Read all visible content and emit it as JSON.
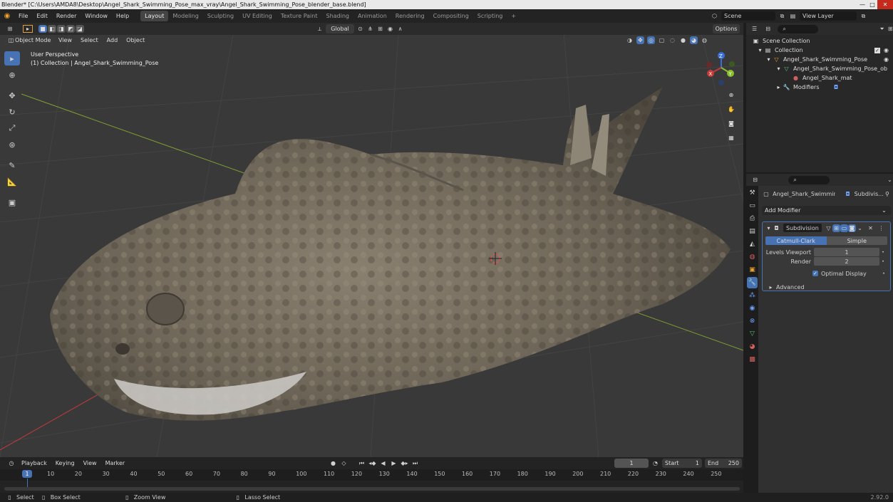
{
  "window": {
    "title": "Blender* [C:\\Users\\AMDA8\\Desktop\\Angel_Shark_Swimming_Pose_max_vray\\Angel_Shark_Swimming_Pose_blender_base.blend]",
    "min": "—",
    "max": "□",
    "close": "✕"
  },
  "menubar": {
    "items": [
      "File",
      "Edit",
      "Render",
      "Window",
      "Help"
    ],
    "workspaces": [
      "Layout",
      "Modeling",
      "Sculpting",
      "UV Editing",
      "Texture Paint",
      "Shading",
      "Animation",
      "Rendering",
      "Compositing",
      "Scripting"
    ],
    "add_tab": "+",
    "scene": "Scene",
    "view_layer": "View Layer"
  },
  "viewport": {
    "mode": "Object Mode",
    "menus": [
      "View",
      "Select",
      "Add",
      "Object"
    ],
    "orientation": "Global",
    "options": "Options",
    "overlay_title": "User Perspective",
    "overlay_subtitle": "(1) Collection | Angel_Shark_Swimming_Pose",
    "gizmo_axes": {
      "x": "X",
      "y": "Y",
      "z": "Z"
    }
  },
  "timeline": {
    "menus": [
      "Playback",
      "Keying",
      "View",
      "Marker"
    ],
    "current_frame": "1",
    "start_label": "Start",
    "start": "1",
    "end_label": "End",
    "end": "250",
    "ticks": [
      "10",
      "20",
      "30",
      "40",
      "50",
      "60",
      "70",
      "80",
      "90",
      "100",
      "110",
      "120",
      "130",
      "140",
      "150",
      "160",
      "170",
      "180",
      "190",
      "200",
      "210",
      "220",
      "230",
      "240",
      "250"
    ],
    "playhead": "1"
  },
  "outliner": {
    "scene_collection": "Scene Collection",
    "collection": "Collection",
    "object": "Angel_Shark_Swimming_Pose",
    "mesh": "Angel_Shark_Swimming_Pose_ob",
    "material": "Angel_Shark_mat",
    "modifiers": "Modifiers"
  },
  "properties": {
    "object_name": "Angel_Shark_Swimmin...",
    "modifier_crumb": "Subdivis...",
    "add_modifier": "Add Modifier",
    "modifier_name": "Subdivision",
    "tab_catmull": "Catmull-Clark",
    "tab_simple": "Simple",
    "levels_viewport_label": "Levels Viewport",
    "levels_viewport": "1",
    "render_label": "Render",
    "render": "2",
    "optimal_display": "Optimal Display",
    "advanced": "Advanced"
  },
  "statusbar": {
    "select": "Select",
    "box_select": "Box Select",
    "zoom_view": "Zoom View",
    "lasso_select": "Lasso Select",
    "version": "2.92.0"
  },
  "colors": {
    "accent": "#4772b3",
    "x_axis": "#c83a3a",
    "y_axis": "#8bbf2f",
    "z_axis": "#3a6fd8"
  }
}
